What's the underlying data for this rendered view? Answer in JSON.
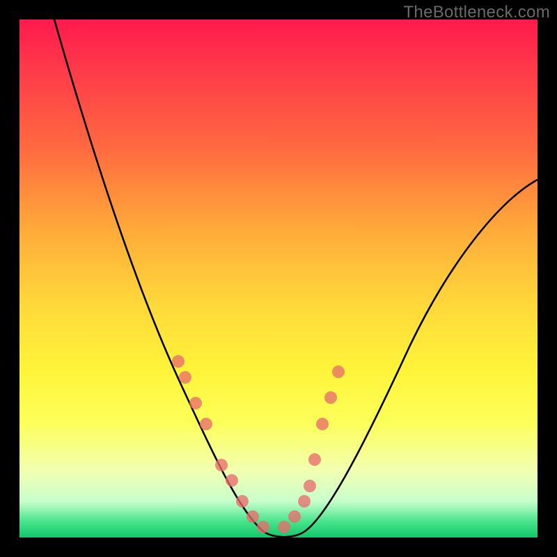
{
  "watermark": "TheBottleneck.com",
  "colors": {
    "frame_bg": "#000000",
    "gradient_top": "#ff1a4d",
    "gradient_bottom": "#12c66c",
    "curve": "#000000",
    "dot": "#e86d6b"
  },
  "chart_data": {
    "type": "line",
    "title": "",
    "xlabel": "",
    "ylabel": "",
    "xlim": [
      0,
      100
    ],
    "ylim": [
      0,
      100
    ],
    "note": "No axis ticks or labels are rendered; values are estimated from curve geometry relative to the plot frame. y=0 at bottom, y=100 at top.",
    "series": [
      {
        "name": "bottleneck-curve",
        "x": [
          0,
          4,
          8,
          12,
          16,
          20,
          24,
          28,
          32,
          36,
          40,
          44,
          48,
          52,
          56,
          60,
          64,
          68,
          72,
          76,
          80,
          84,
          88,
          92,
          96,
          100
        ],
        "y": [
          100,
          92,
          84,
          76,
          68,
          60,
          50,
          40,
          30,
          20,
          12,
          5,
          1,
          0,
          1,
          5,
          11,
          18,
          25,
          32,
          39,
          46,
          52,
          58,
          63,
          68
        ]
      }
    ],
    "markers": {
      "name": "highlight-dots",
      "x": [
        30.5,
        32,
        34,
        36,
        39,
        41,
        43,
        45,
        47,
        51,
        53,
        55,
        56,
        57,
        58.5,
        60,
        61.5
      ],
      "y": [
        34,
        31,
        26,
        22,
        14,
        11,
        7,
        4,
        2,
        2,
        4,
        7,
        10,
        15,
        22,
        27,
        32
      ]
    }
  }
}
